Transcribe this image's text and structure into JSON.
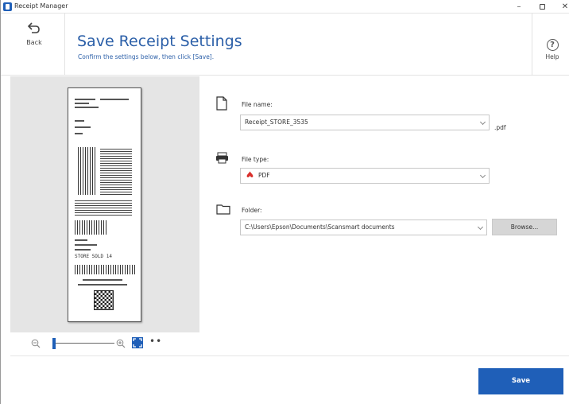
{
  "window": {
    "title": "Receipt Manager",
    "minimize": "–",
    "close": "✕"
  },
  "header": {
    "back_label": "Back",
    "title": "Save Receipt Settings",
    "subtitle": "Confirm the settings below, then click [Save].",
    "help_label": "Help",
    "help_glyph": "?"
  },
  "preview": {
    "receipt_text": [
      "STORE SOLD 14"
    ],
    "zoom_level": 0.05,
    "more_label": "••"
  },
  "settings": {
    "file_name": {
      "label": "File name:",
      "value": "Receipt_STORE_3535",
      "extension": ".pdf"
    },
    "file_type": {
      "label": "File type:",
      "value": "PDF"
    },
    "folder": {
      "label": "Folder:",
      "value": "C:\\Users\\Epson\\Documents\\Scansmart documents",
      "browse_label": "Browse..."
    }
  },
  "footer": {
    "save_label": "Save"
  },
  "colors": {
    "accent": "#1f5fb8",
    "title": "#2b5fa8",
    "pdf_icon": "#d9302c"
  }
}
